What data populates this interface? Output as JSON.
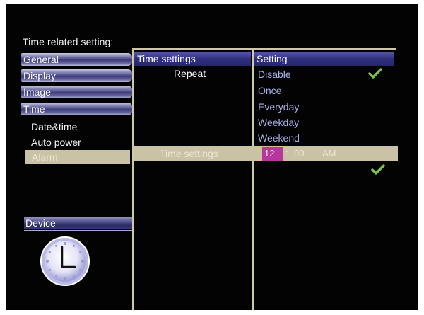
{
  "header": {
    "title": "Time related setting:"
  },
  "sidebar": {
    "items": [
      {
        "label": "General"
      },
      {
        "label": "Display"
      },
      {
        "label": "Image"
      },
      {
        "label": "Time"
      }
    ],
    "time_subitems": [
      {
        "label": "Date&time"
      },
      {
        "label": "Auto power"
      },
      {
        "label": "Alarm",
        "selected": true
      }
    ],
    "device_label": "Device",
    "clock_icon": "analog-clock-icon"
  },
  "middle_column": {
    "header": "Time settings",
    "repeat_label": "Repeat",
    "time_settings_label": "Time settings"
  },
  "right_column": {
    "header": "Setting",
    "options": [
      {
        "label": "Disable",
        "checked": true
      },
      {
        "label": "Once"
      },
      {
        "label": "Everyday"
      },
      {
        "label": "Weekday"
      },
      {
        "label": "Weekend"
      }
    ],
    "time": {
      "hour": "12",
      "separator": ":",
      "minute": "00",
      "period": "AM",
      "confirmed": true
    }
  },
  "colors": {
    "background": "#030303",
    "header_blue": "#2f2f80",
    "option_text": "#a9b2ea",
    "selection_bar": "#c9c2a4",
    "hour_highlight": "#b6379e",
    "checkmark": "#7fc24a",
    "divider": "#cfc8a6"
  },
  "icons": {
    "check": "checkmark-icon"
  }
}
